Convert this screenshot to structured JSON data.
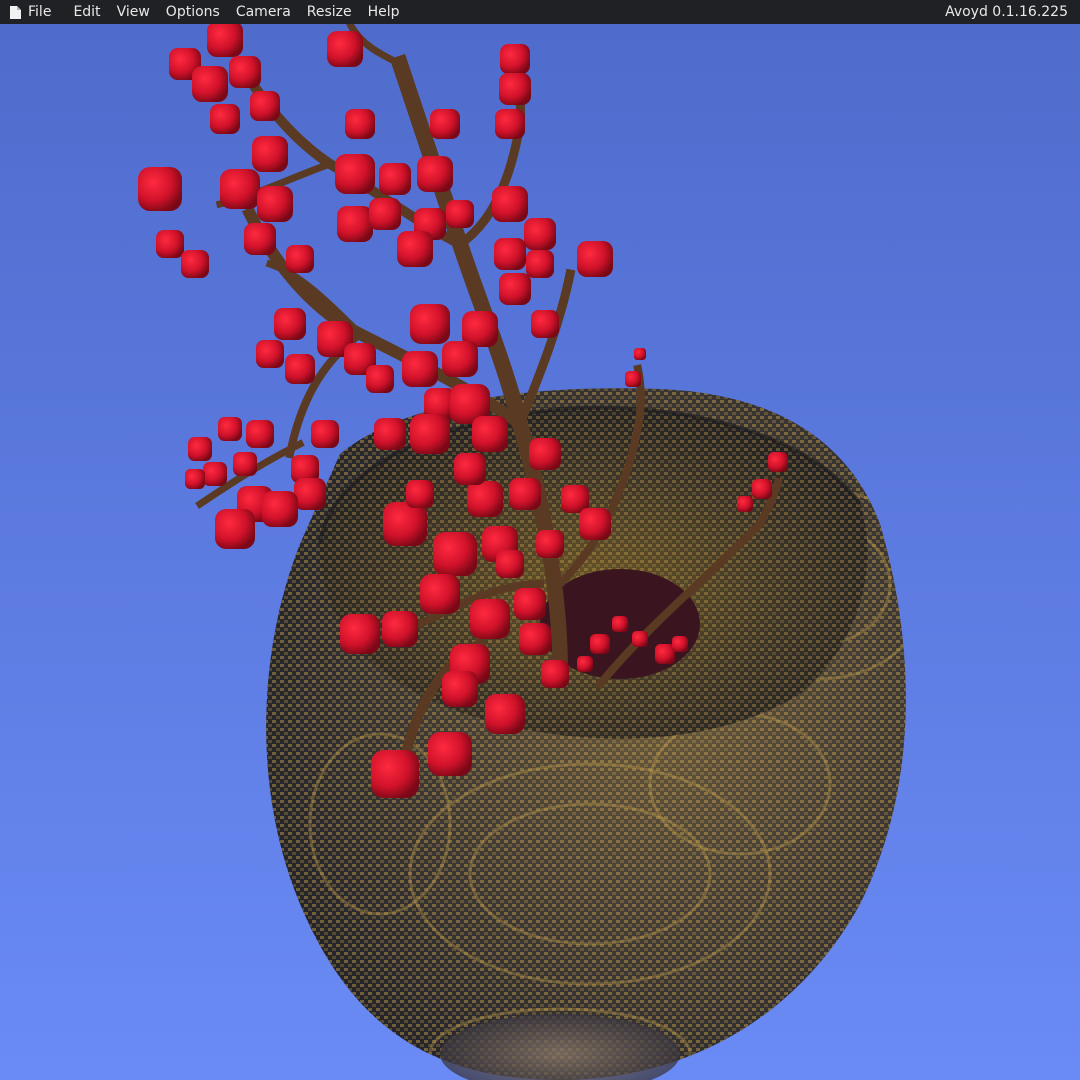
{
  "app": {
    "version": "Avoyd 0.1.16.225"
  },
  "menubar": {
    "items": [
      {
        "label": "File",
        "icon": "file-icon"
      },
      {
        "label": "Edit"
      },
      {
        "label": "View"
      },
      {
        "label": "Options"
      },
      {
        "label": "Camera"
      },
      {
        "label": "Resize"
      },
      {
        "label": "Help"
      }
    ]
  },
  "colors": {
    "menubar_bg": "#202124",
    "menubar_text": "#e8e8e8",
    "sky_top": "#4f6ccc",
    "sky_bottom": "#6a8af5",
    "vase_dark": "#2a2a2e",
    "vase_gold": "#b08a3a",
    "berry_red": "#d0122a",
    "berry_dark": "#8a0a1a",
    "branch_brown": "#5a3a22"
  }
}
